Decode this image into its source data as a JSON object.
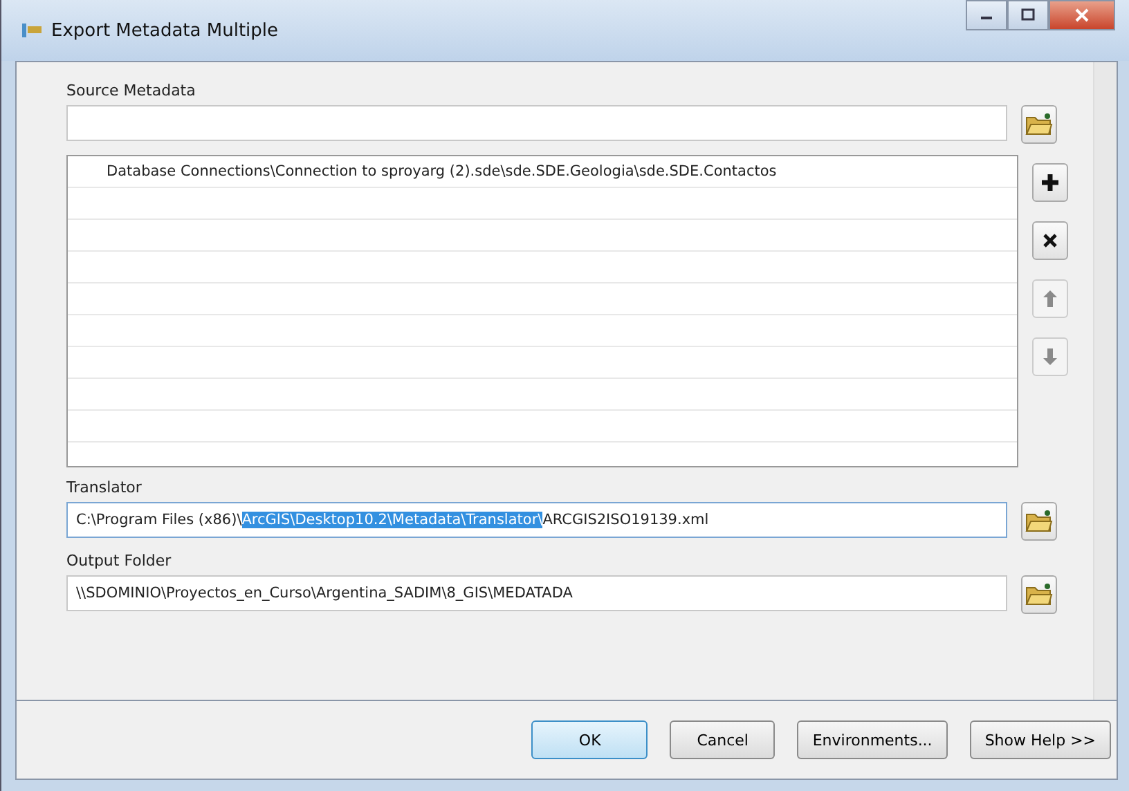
{
  "window": {
    "title": "Export Metadata Multiple"
  },
  "source_metadata": {
    "label": "Source Metadata",
    "rows": [
      "Database Connections\\Connection to sproyarg (2).sde\\sde.SDE.Geologia\\sde.SDE.Contactos"
    ],
    "list_buttons": [
      {
        "kind": "add",
        "disabled": false
      },
      {
        "kind": "remove",
        "disabled": false
      },
      {
        "kind": "up",
        "disabled": true
      },
      {
        "kind": "down",
        "disabled": true
      }
    ]
  },
  "translator": {
    "label": "Translator",
    "value_before": "C:\\Program Files (x86)\\",
    "value_selected": "ArcGIS\\Desktop10.2\\Metadata\\Translator\\",
    "value_after": "ARCGIS2ISO19139.xml"
  },
  "output_folder": {
    "label": "Output Folder",
    "value": "\\\\SDOMINIO\\Proyectos_en_Curso\\Argentina_SADIM\\8_GIS\\MEDATADA"
  },
  "buttons": [
    {
      "label": "OK",
      "default": true
    },
    {
      "label": "Cancel",
      "default": false
    },
    {
      "label": "Environments...",
      "default": false
    },
    {
      "label": "Show Help >>",
      "default": false
    }
  ]
}
